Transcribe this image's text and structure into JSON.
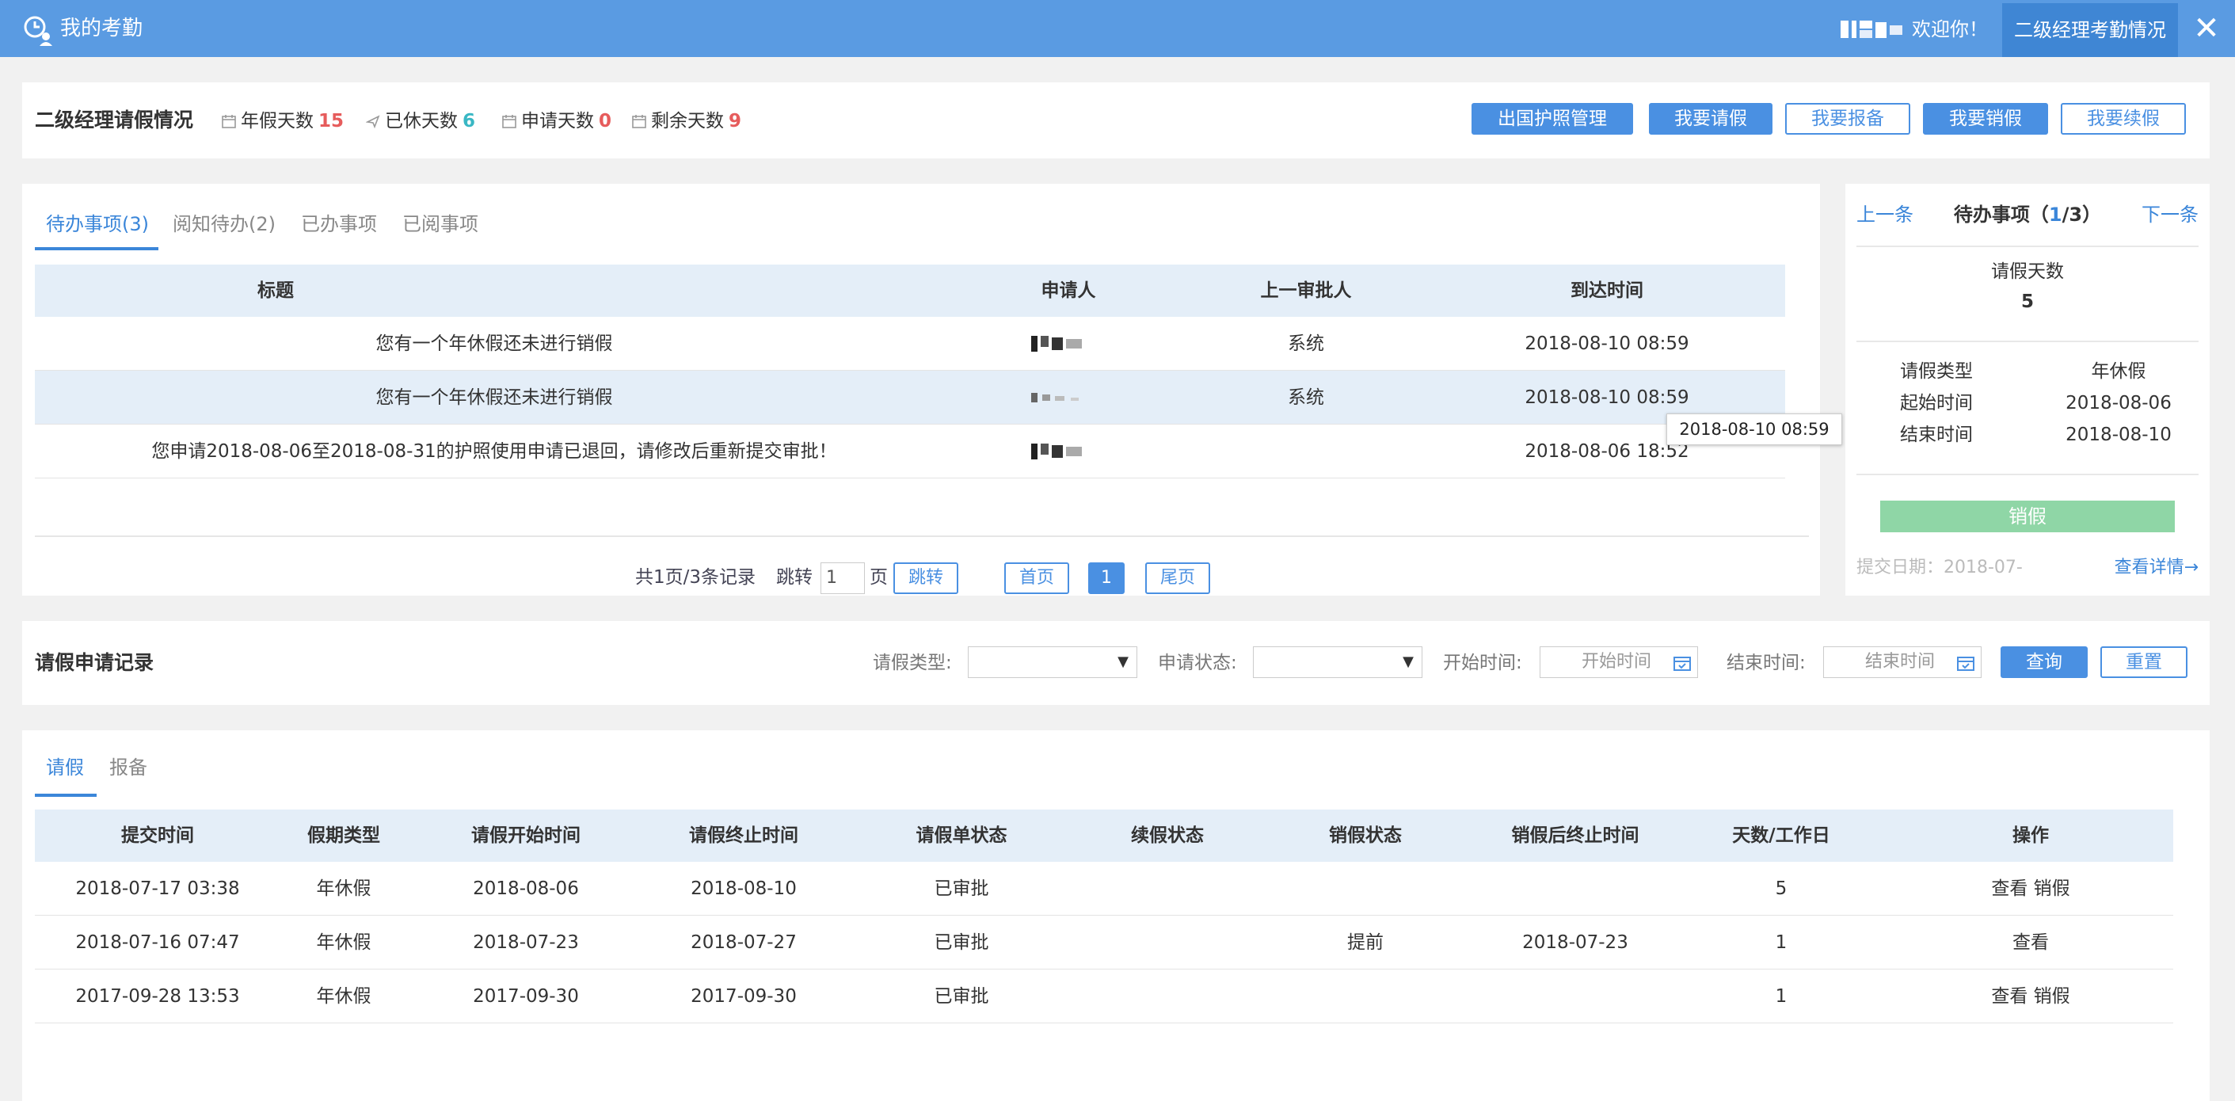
{
  "header": {
    "title": "我的考勤",
    "welcome": "欢迎你！",
    "role_tab": "二级经理考勤情况",
    "close": "✕"
  },
  "stats": {
    "title": "二级经理请假情况",
    "items": [
      {
        "label": "年假天数",
        "value": "15",
        "color": "#e65c5c"
      },
      {
        "label": "已休天数",
        "value": "6",
        "color": "#39b7c4"
      },
      {
        "label": "申请天数",
        "value": "0",
        "color": "#e65c5c"
      },
      {
        "label": "剩余天数",
        "value": "9",
        "color": "#e65c5c"
      }
    ],
    "buttons": [
      "出国护照管理",
      "我要请假",
      "我要报备",
      "我要销假",
      "我要续假"
    ]
  },
  "todo": {
    "tabs": [
      "待办事项(3)",
      "阅知待办(2)",
      "已办事项",
      "已阅事项"
    ],
    "columns": [
      "标题",
      "申请人",
      "上一审批人",
      "到达时间"
    ],
    "rows": [
      {
        "title": "您有一个年休假还未进行销假",
        "approver": "系统",
        "time": "2018-08-10 08:59"
      },
      {
        "title": "您有一个年休假还未进行销假",
        "approver": "系统",
        "time": "2018-08-10 08:59"
      },
      {
        "title": "您申请2018-08-06至2018-08-31的护照使用申请已退回，请修改后重新提交审批！",
        "approver": "",
        "time": "2018-08-06 18:52"
      }
    ],
    "tooltip": "2018-08-10 08:59",
    "pager": {
      "summary": "共1页/3条记录",
      "jump_label": "跳转",
      "page_value": "1",
      "page_suffix": "页",
      "jump_button": "跳转",
      "first": "首页",
      "current": "1",
      "last": "尾页"
    }
  },
  "side": {
    "prev": "上一条",
    "title_prefix": "待办事项（",
    "title_current": "1",
    "title_suffix": "/3）",
    "next": "下一条",
    "days_label": "请假天数",
    "days_value": "5",
    "type_label": "请假类型",
    "type_value": "年休假",
    "start_label": "起始时间",
    "start_value": "2018-08-06",
    "end_label": "结束时间",
    "end_value": "2018-08-10",
    "action": "销假",
    "submit_date": "提交日期：2018-07-",
    "detail": "查看详情→"
  },
  "filter": {
    "title": "请假申请记录",
    "type_label": "请假类型:",
    "status_label": "申请状态:",
    "start_label": "开始时间:",
    "start_placeholder": "开始时间",
    "end_label": "结束时间:",
    "end_placeholder": "结束时间",
    "query": "查询",
    "reset": "重置"
  },
  "records": {
    "tabs": [
      "请假",
      "报备"
    ],
    "columns": [
      "提交时间",
      "假期类型",
      "请假开始时间",
      "请假终止时间",
      "请假单状态",
      "续假状态",
      "销假状态",
      "销假后终止时间",
      "天数/工作日",
      "操作"
    ],
    "rows": [
      {
        "submit": "2018-07-17 03:38",
        "type": "年休假",
        "start": "2018-08-06",
        "end": "2018-08-10",
        "status": "已审批",
        "renew": "",
        "cancel": "",
        "cancel_end": "",
        "days": "5",
        "actions": [
          "查看",
          "销假"
        ]
      },
      {
        "submit": "2018-07-16 07:47",
        "type": "年休假",
        "start": "2018-07-23",
        "end": "2018-07-27",
        "status": "已审批",
        "renew": "",
        "cancel": "提前",
        "cancel_end": "2018-07-23",
        "days": "1",
        "actions": [
          "查看"
        ]
      },
      {
        "submit": "2017-09-28 13:53",
        "type": "年休假",
        "start": "2017-09-30",
        "end": "2017-09-30",
        "status": "已审批",
        "renew": "",
        "cancel": "",
        "cancel_end": "",
        "days": "1",
        "actions": [
          "查看",
          "销假"
        ]
      }
    ]
  },
  "colors": {
    "header_bg": "#5a9be2",
    "accent": "#4a90e2",
    "link": "#3b86d9",
    "danger_num": "#e65c5c",
    "teal_num": "#39b7c4",
    "row_highlight": "#e4eef8",
    "success_btn": "#8fd6a6"
  }
}
